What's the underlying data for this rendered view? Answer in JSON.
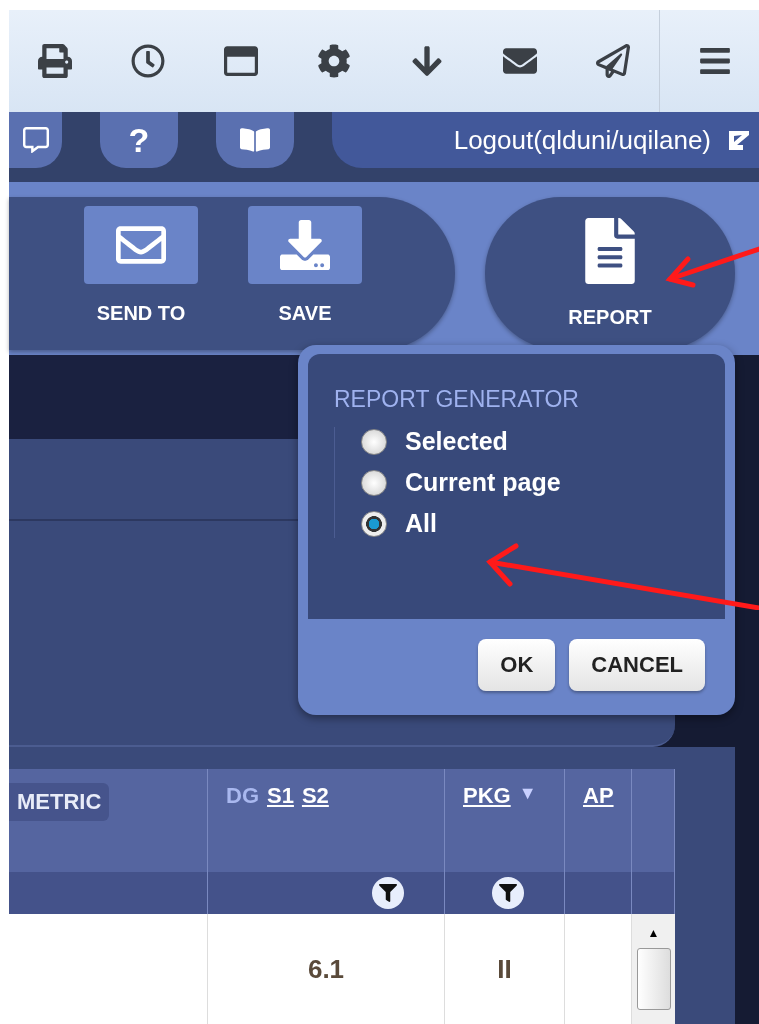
{
  "header": {
    "help_label": "?",
    "logout_label": "Logout(qlduni/uqilane)"
  },
  "actions": [
    {
      "kind": "send",
      "label": "SEND TO"
    },
    {
      "kind": "save",
      "label": "SAVE"
    }
  ],
  "report": {
    "label": "REPORT"
  },
  "popup": {
    "title": "REPORT GENERATOR",
    "options": [
      {
        "label": "Selected",
        "selected": false
      },
      {
        "label": "Current page",
        "selected": false
      },
      {
        "label": "All",
        "selected": true
      }
    ],
    "buttons": [
      "OK",
      "CANCEL"
    ]
  },
  "table": {
    "columns": [
      {
        "kind": "tag",
        "label": "METRIC",
        "filter": false
      },
      {
        "kind": "dg",
        "label": "DG",
        "links": [
          "S1",
          "S2"
        ],
        "filter": true
      },
      {
        "kind": "link",
        "label": "PKG",
        "sort_indicator": "▼",
        "filter": true
      },
      {
        "kind": "link",
        "label": "AP",
        "filter": false
      }
    ],
    "scroll_up": "▲",
    "rows": [
      {
        "cells": [
          "",
          "6.1",
          "II",
          ""
        ]
      }
    ]
  }
}
